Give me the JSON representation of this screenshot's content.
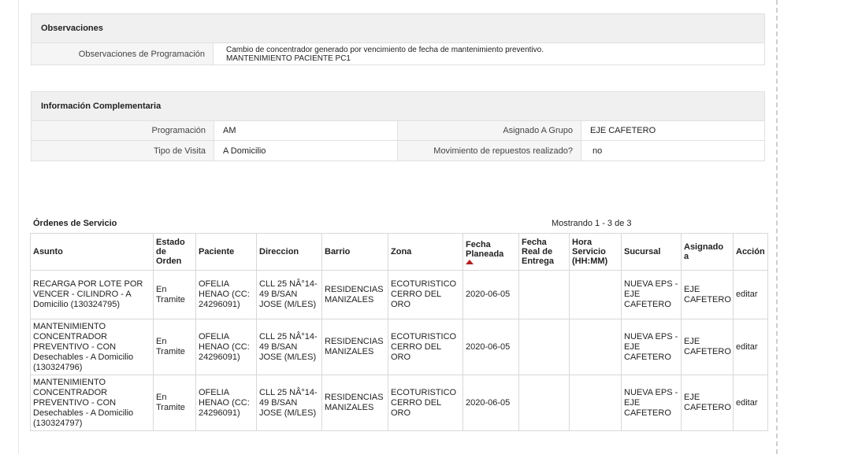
{
  "observaciones": {
    "title": "Observaciones",
    "label": "Observaciones de Programación",
    "value_line1": "Cambio de concentrador generado por vencimiento de fecha de mantenimiento preventivo.",
    "value_line2": "MANTENIMIENTO PACIENTE PC1"
  },
  "complementaria": {
    "title": "Información Complementaria",
    "rows": [
      {
        "label1": "Programación",
        "value1": "AM",
        "label2": "Asignado A Grupo",
        "value2": "EJE CAFETERO"
      },
      {
        "label1": "Tipo de Visita",
        "value1": "A Domicilio",
        "label2": "Movimiento de repuestos realizado?",
        "value2": "no"
      }
    ]
  },
  "ordenes": {
    "title": "Órdenes de Servicio",
    "count": "Mostrando 1 - 3 de 3",
    "headers": {
      "asunto": "Asunto",
      "estado": "Estado de Orden",
      "paciente": "Paciente",
      "direccion": "Direccion",
      "barrio": "Barrio",
      "zona": "Zona",
      "fecha_planeada": "Fecha Planeada",
      "fecha_real": "Fecha Real de Entrega",
      "hora": "Hora Servicio (HH:MM)",
      "sucursal": "Sucursal",
      "asignado": "Asignado a",
      "accion": "Acción"
    },
    "rows": [
      {
        "asunto": "RECARGA POR LOTE POR VENCER - CILINDRO - A Domicilio (130324795)",
        "estado": "En Tramite",
        "paciente": "OFELIA HENAO (CC: 24296091)",
        "direccion": "CLL 25 NÂ°14-49 B/SAN JOSE (M/LES)",
        "barrio": "RESIDENCIAS MANIZALES",
        "zona": "ECOTURISTICO CERRO DEL ORO",
        "fecha_planeada": "2020-06-05",
        "fecha_real": "",
        "hora": "",
        "sucursal": "NUEVA EPS - EJE CAFETERO",
        "asignado": "EJE CAFETERO",
        "accion": "editar"
      },
      {
        "asunto": "MANTENIMIENTO CONCENTRADOR PREVENTIVO - CON Desechables - A Domicilio (130324796)",
        "estado": "En Tramite",
        "paciente": "OFELIA HENAO (CC: 24296091)",
        "direccion": "CLL 25 NÂ°14-49 B/SAN JOSE (M/LES)",
        "barrio": "RESIDENCIAS MANIZALES",
        "zona": "ECOTURISTICO CERRO DEL ORO",
        "fecha_planeada": "2020-06-05",
        "fecha_real": "",
        "hora": "",
        "sucursal": "NUEVA EPS - EJE CAFETERO",
        "asignado": "EJE CAFETERO",
        "accion": "editar"
      },
      {
        "asunto": "MANTENIMIENTO CONCENTRADOR PREVENTIVO - CON Desechables - A Domicilio (130324797)",
        "estado": "En Tramite",
        "paciente": "OFELIA HENAO (CC: 24296091)",
        "direccion": "CLL 25 NÂ°14-49 B/SAN JOSE (M/LES)",
        "barrio": "RESIDENCIAS MANIZALES",
        "zona": "ECOTURISTICO CERRO DEL ORO",
        "fecha_planeada": "2020-06-05",
        "fecha_real": "",
        "hora": "",
        "sucursal": "NUEVA EPS - EJE CAFETERO",
        "asignado": "EJE CAFETERO",
        "accion": "editar"
      }
    ]
  },
  "icons": {
    "sort": "sort-ascending-icon"
  },
  "colors": {
    "sort_arrow": "#b02020",
    "panel_header_bg": "#f0f0f0",
    "label_bg": "#f5f5f5"
  }
}
